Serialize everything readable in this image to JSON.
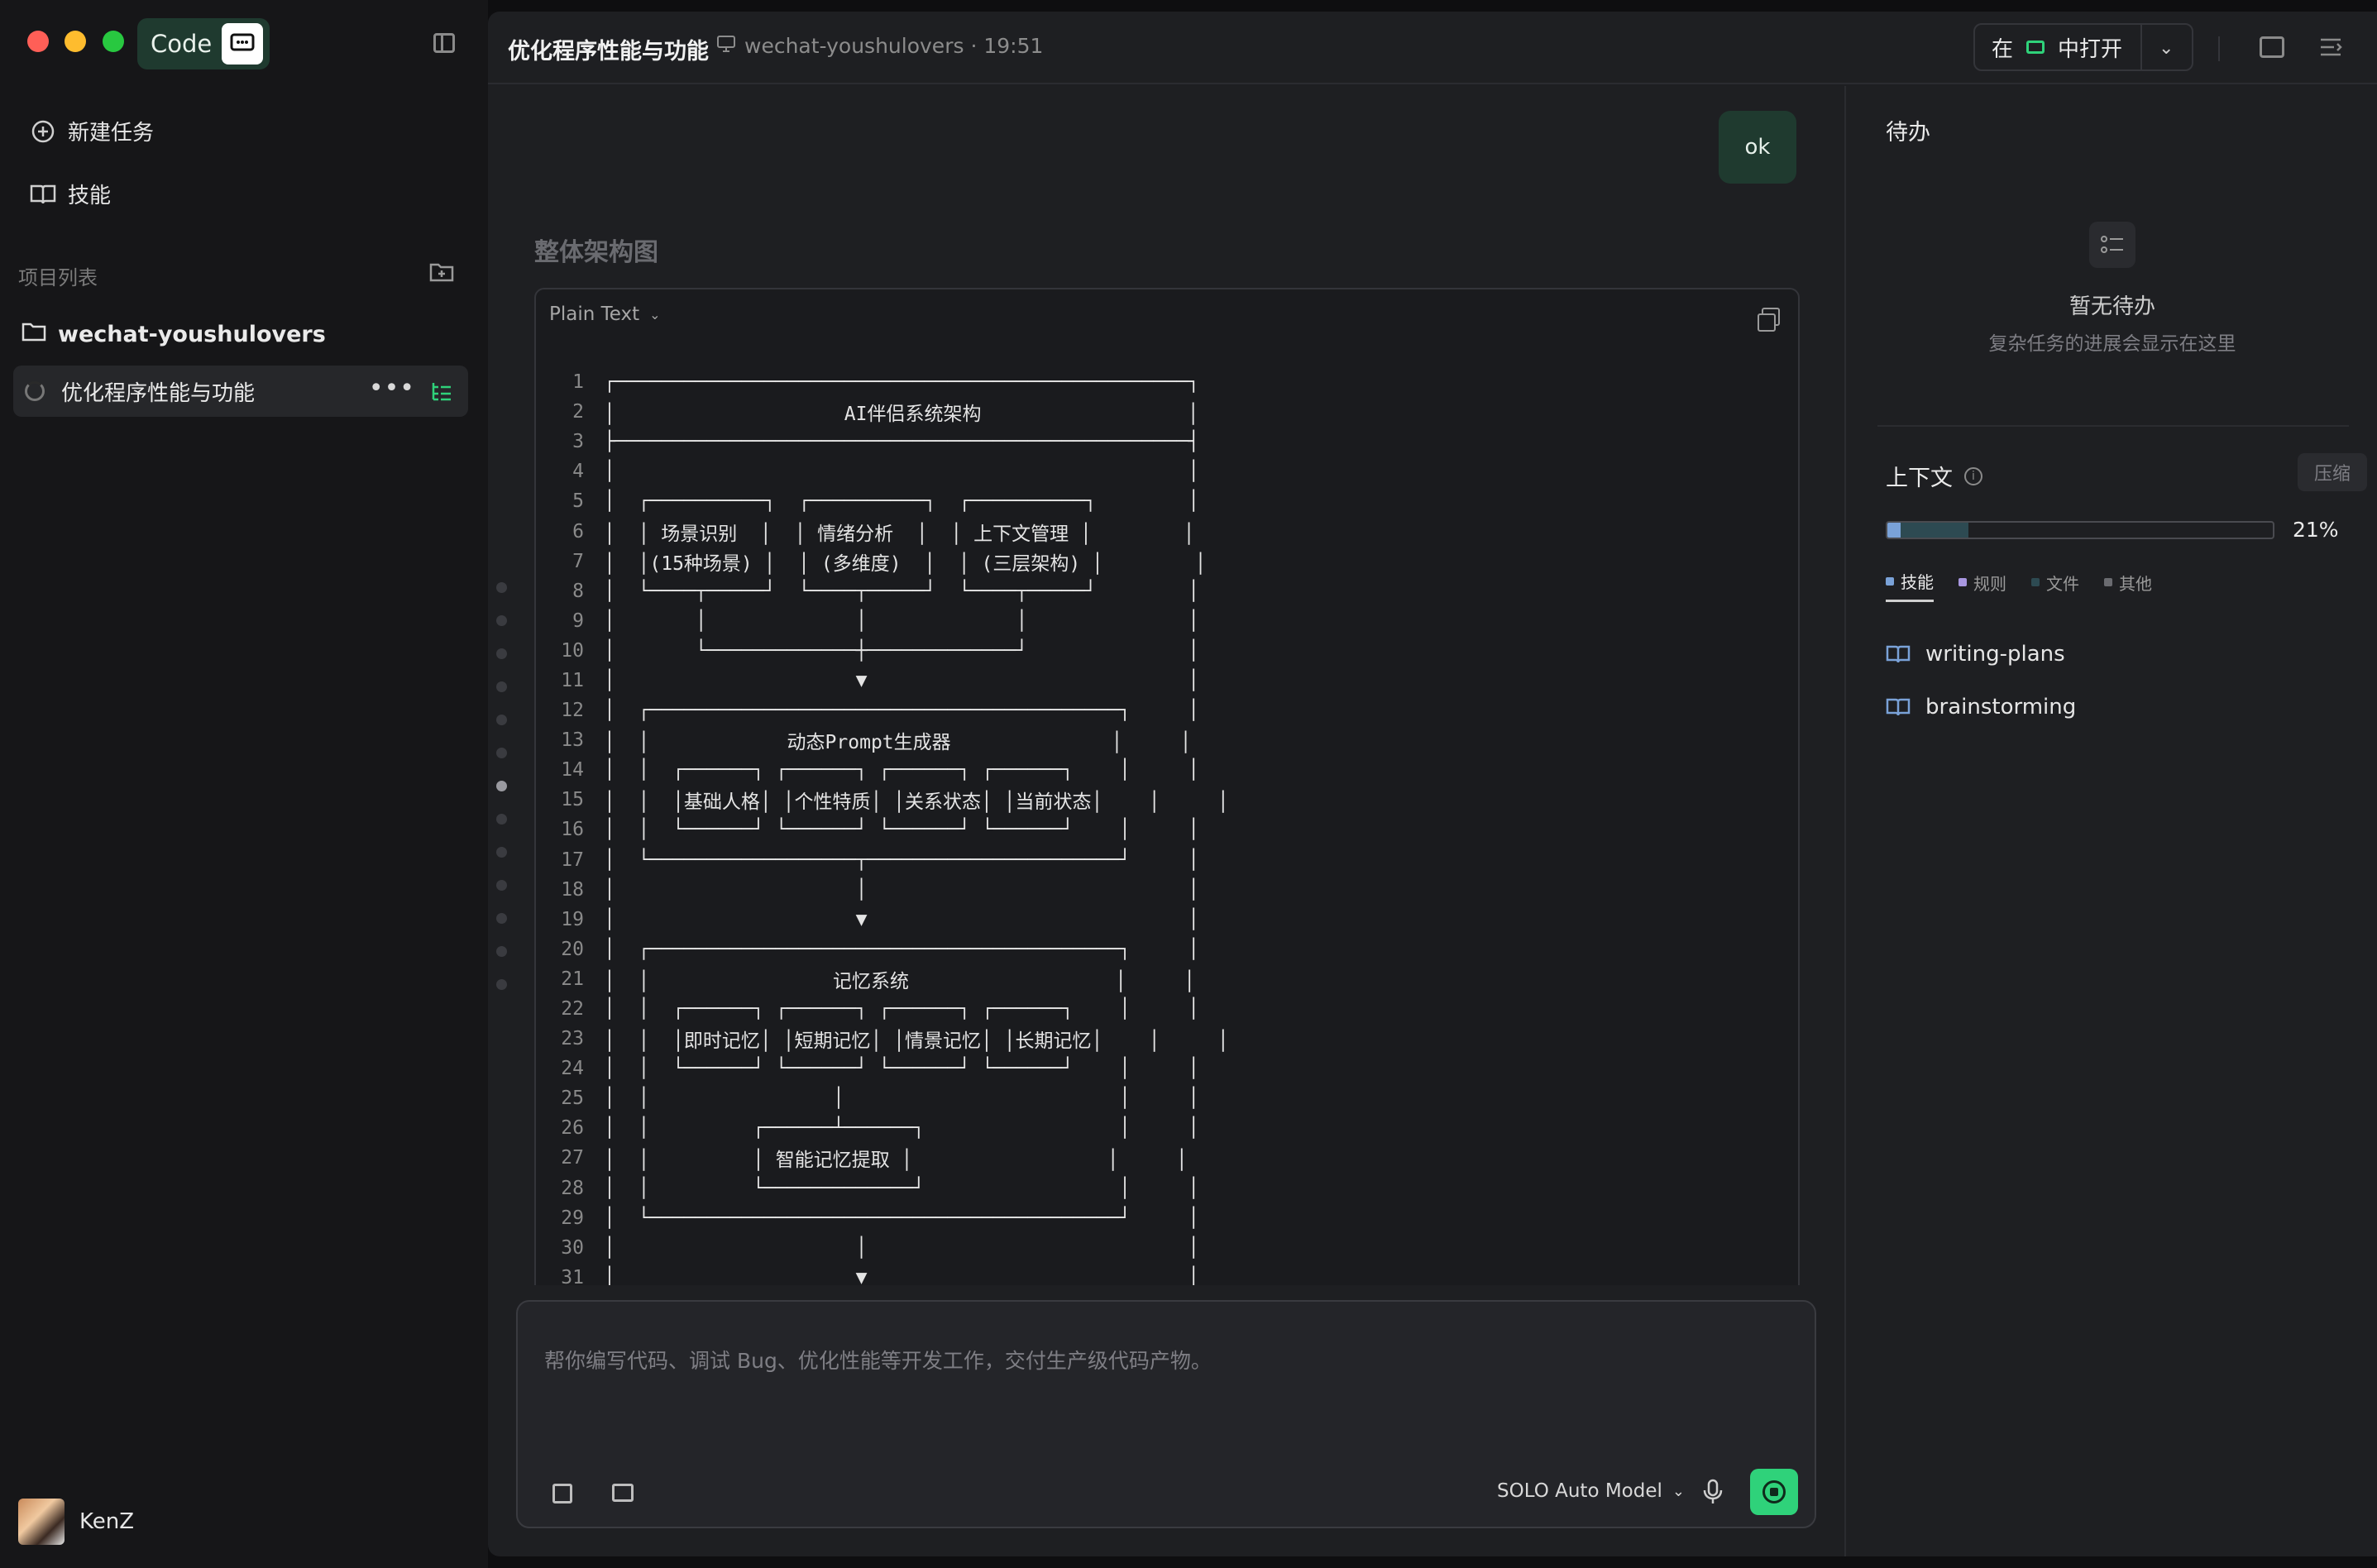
{
  "app": {
    "name": "Code"
  },
  "sidebar": {
    "new_task": "新建任务",
    "skills": "技能",
    "section_label": "项目列表",
    "project": "wechat-youshulovers",
    "task": "优化程序性能与功能",
    "user": "KenZ"
  },
  "header": {
    "title": "优化程序性能与功能",
    "meta": "wechat-youshulovers · 19:51",
    "open_in_prefix": "在",
    "open_in_suffix": "中打开"
  },
  "chat": {
    "user_message": "ok",
    "section_heading": "整体架构图",
    "code_language": "Plain Text",
    "code_lines": [
      "┌──────────────────────────────────────────────────┐",
      "│                    AI伴侣系统架构                  │",
      "├──────────────────────────────────────────────────┤",
      "│                                                  │",
      "│  ┌──────────┐  ┌──────────┐  ┌──────────┐        │",
      "│  │ 场景识别  │  │ 情绪分析  │  │ 上下文管理 │        │",
      "│  │(15种场景) │  │ (多维度)  │  │ (三层架构) │        │",
      "│  └────┬─────┘  └────┬─────┘  └────┬─────┘        │",
      "│       │             │             │              │",
      "│       └─────────────┼─────────────┘              │",
      "│                     ▼                            │",
      "│  ┌─────────────────────────────────────────┐     │",
      "│  │            动态Prompt生成器              │     │",
      "│  │  ┌──────┐ ┌──────┐ ┌──────┐ ┌──────┐    │     │",
      "│  │  │基础人格│ │个性特质│ │关系状态│ │当前状态│    │     │",
      "│  │  └──────┘ └──────┘ └──────┘ └──────┘    │     │",
      "│  └──────────────────┬──────────────────────┘     │",
      "│                     │                            │",
      "│                     ▼                            │",
      "│  ┌─────────────────────────────────────────┐     │",
      "│  │                记忆系统                  │     │",
      "│  │  ┌──────┐ ┌──────┐ ┌──────┐ ┌──────┐    │     │",
      "│  │  │即时记忆│ │短期记忆│ │情景记忆│ │长期记忆│    │     │",
      "│  │  └──────┘ └──────┘ └──────┘ └──────┘    │     │",
      "│  │                │                        │     │",
      "│  │         ┌──────┴──────┐                 │     │",
      "│  │         │ 智能记忆提取 │                 │     │",
      "│  │         └─────────────┘                 │     │",
      "│  └─────────────────────────────────────────┘     │",
      "│                     │                            │",
      "│                     ▼                            │",
      "│  ┌─────────────────────────────────────────┐     │"
    ]
  },
  "composer": {
    "placeholder": "帮你编写代码、调试 Bug、优化性能等开发工作，交付生产级代码产物。",
    "model": "SOLO Auto Model"
  },
  "right_panel": {
    "todo_title": "待办",
    "todo_empty": "暂无待办",
    "todo_desc": "复杂任务的进展会显示在这里",
    "context_title": "上下文",
    "compress": "压缩",
    "context_percent": "21%",
    "context_fraction": 0.21,
    "tabs": [
      {
        "label": "技能",
        "color": "#7aa2d8"
      },
      {
        "label": "规则",
        "color": "#a897e0"
      },
      {
        "label": "文件",
        "color": "#2d4a52"
      },
      {
        "label": "其他",
        "color": "#6a6b70"
      }
    ],
    "skills": [
      "writing-plans",
      "brainstorming"
    ]
  },
  "colors": {
    "accent": "#2fd27a",
    "bubble": "#1f3a2f"
  }
}
